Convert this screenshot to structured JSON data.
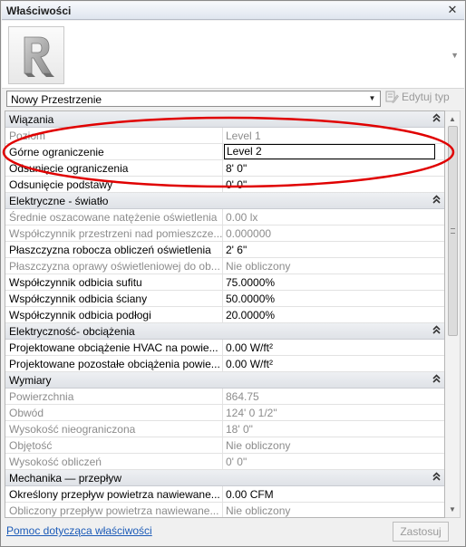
{
  "window": {
    "title": "Właściwości",
    "close_glyph": "✕"
  },
  "type_selector": {
    "selected": "Nowy Przestrzenie",
    "edit_type_label": "Edytuj typ"
  },
  "groups": [
    {
      "title": "Wiązania",
      "rows": [
        {
          "name": "Poziom",
          "value": "Level 1",
          "dim": true
        },
        {
          "name": "Górne ograniczenie",
          "value": "Level 2",
          "dim": false,
          "editing": true
        },
        {
          "name": "Odsunięcie ograniczenia",
          "value": "8'  0\"",
          "dim": false
        },
        {
          "name": "Odsunięcie podstawy",
          "value": "0'  0\"",
          "dim": false
        }
      ]
    },
    {
      "title": "Elektryczne - światło",
      "rows": [
        {
          "name": "Średnie oszacowane natężenie oświetlenia",
          "value": "0.00 lx",
          "dim": true
        },
        {
          "name": "Współczynnik przestrzeni nad pomieszcze...",
          "value": "0.000000",
          "dim": true
        },
        {
          "name": "Płaszczyzna robocza obliczeń oświetlenia",
          "value": "2'  6\"",
          "dim": false
        },
        {
          "name": "Płaszczyzna oprawy oświetleniowej do ob...",
          "value": "Nie obliczony",
          "dim": true
        },
        {
          "name": "Współczynnik odbicia sufitu",
          "value": "75.0000%",
          "dim": false
        },
        {
          "name": "Współczynnik odbicia ściany",
          "value": "50.0000%",
          "dim": false
        },
        {
          "name": "Współczynnik odbicia podłogi",
          "value": "20.0000%",
          "dim": false
        }
      ]
    },
    {
      "title": "Elektryczność- obciążenia",
      "rows": [
        {
          "name": "Projektowane obciążenie HVAC na powie...",
          "value": "0.00 W/ft²",
          "dim": false
        },
        {
          "name": "Projektowane pozostałe obciążenia powie...",
          "value": "0.00 W/ft²",
          "dim": false
        }
      ]
    },
    {
      "title": "Wymiary",
      "rows": [
        {
          "name": "Powierzchnia",
          "value": "864.75",
          "dim": true
        },
        {
          "name": "Obwód",
          "value": "124'  0 1/2\"",
          "dim": true
        },
        {
          "name": "Wysokość nieograniczona",
          "value": "18'  0\"",
          "dim": true
        },
        {
          "name": "Objętość",
          "value": "Nie obliczony",
          "dim": true
        },
        {
          "name": "Wysokość obliczeń",
          "value": "0'  0\"",
          "dim": true
        }
      ]
    },
    {
      "title": "Mechanika — przepływ",
      "rows": [
        {
          "name": "Określony przepływ powietrza nawiewane...",
          "value": "0.00 CFM",
          "dim": false
        },
        {
          "name": "Obliczony przepływ powietrza nawiewane...",
          "value": "Nie obliczony",
          "dim": true
        }
      ]
    }
  ],
  "footer": {
    "help_link": "Pomoc dotycząca właściwości",
    "apply_label": "Zastosuj"
  },
  "icons": {
    "logo": "revit-r-logo-icon",
    "collapse": "double-chevron-up-icon",
    "dropdown": "triangle-down-icon",
    "edit_type": "edit-type-icon"
  },
  "colors": {
    "annotation_ellipse": "#e00000",
    "link": "#1c5bb8",
    "dim_text": "#8c8c8c"
  }
}
